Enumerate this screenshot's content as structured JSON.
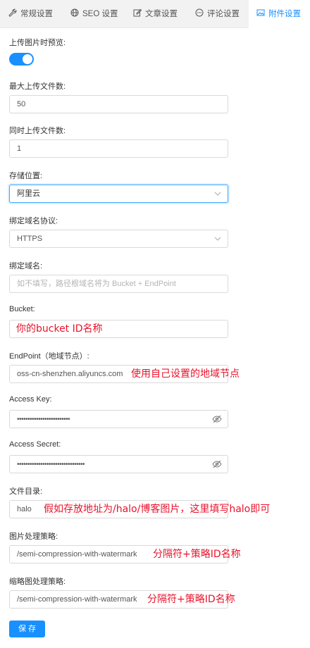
{
  "tabs": [
    {
      "label": "常规设置",
      "icon": "wrench-icon"
    },
    {
      "label": "SEO 设置",
      "icon": "globe-icon"
    },
    {
      "label": "文章设置",
      "icon": "edit-icon"
    },
    {
      "label": "评论设置",
      "icon": "comment-icon"
    },
    {
      "label": "附件设置",
      "icon": "image-icon",
      "active": true
    }
  ],
  "form": {
    "preview": {
      "label": "上传图片时预览:",
      "enabled": true
    },
    "max_files": {
      "label": "最大上传文件数:",
      "value": "50"
    },
    "concurrent": {
      "label": "同时上传文件数:",
      "value": "1"
    },
    "storage": {
      "label": "存储位置:",
      "value": "阿里云"
    },
    "protocol": {
      "label": "绑定域名协议:",
      "value": "HTTPS"
    },
    "domain": {
      "label": "绑定域名:",
      "placeholder": "如不填写，路径根域名将为 Bucket + EndPoint"
    },
    "bucket": {
      "label": "Bucket:",
      "value": ""
    },
    "endpoint": {
      "label": "EndPoint（地域节点）:",
      "value": "oss-cn-shenzhen.aliyuncs.com"
    },
    "access_key": {
      "label": "Access Key:",
      "value": "•••••••••••••••••••••••••"
    },
    "access_secret": {
      "label": "Access Secret:",
      "value": "••••••••••••••••••••••••••••••••"
    },
    "directory": {
      "label": "文件目录:",
      "value": "halo"
    },
    "image_policy": {
      "label": "图片处理策略:",
      "value": "/semi-compression-with-watermark"
    },
    "thumb_policy": {
      "label": "缩略图处理策略:",
      "value": "/semi-compression-with-watermark"
    }
  },
  "annotations": {
    "bucket": "你的bucket ID名称",
    "endpoint": "使用自己设置的地域节点",
    "directory": "假如存放地址为/halo/博客图片，这里填写halo即可",
    "image_policy": "分隔符+策略ID名称",
    "thumb_policy": "分隔符+策略ID名称"
  },
  "save_label": "保 存",
  "colors": {
    "accent": "#1890ff",
    "annotation": "#e8132b"
  }
}
